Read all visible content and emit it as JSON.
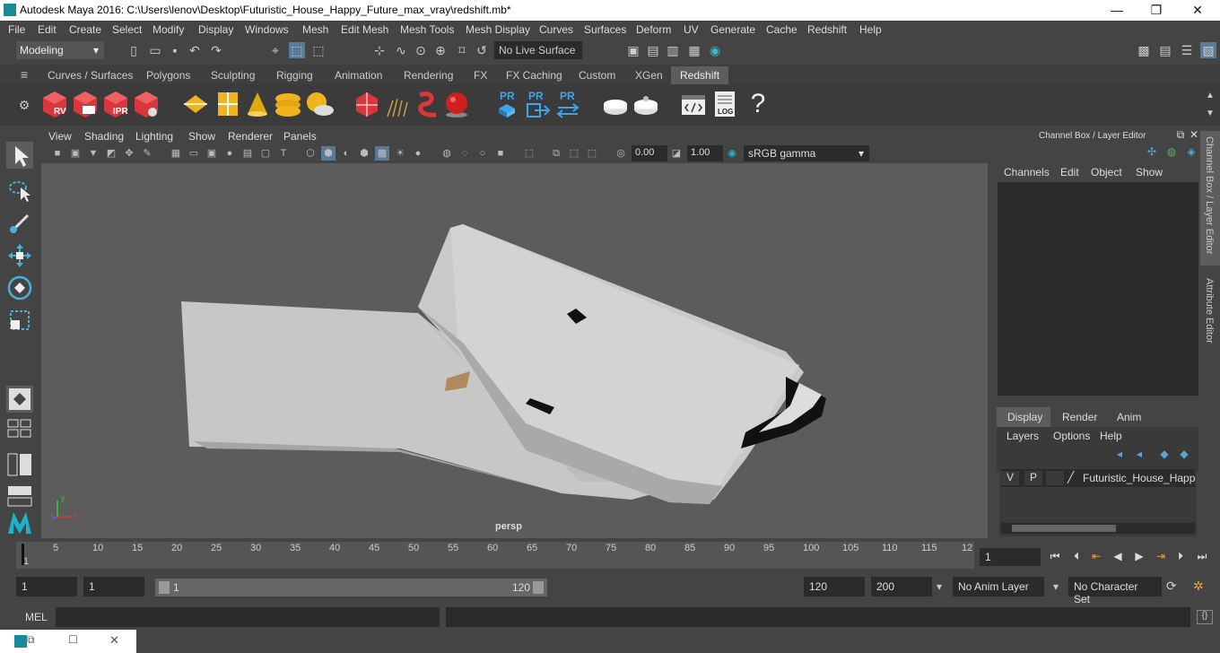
{
  "window": {
    "title": "Autodesk Maya 2016: C:\\Users\\lenov\\Desktop\\Futuristic_House_Happy_Future_max_vray\\redshift.mb*",
    "minimize": "—",
    "maximize": "❐",
    "close": "✕"
  },
  "menubar": {
    "items": [
      "File",
      "Edit",
      "Create",
      "Select",
      "Modify",
      "Display",
      "Windows",
      "Mesh",
      "Edit Mesh",
      "Mesh Tools",
      "Mesh Display",
      "Curves",
      "Surfaces",
      "Deform",
      "UV",
      "Generate",
      "Cache",
      "Redshift",
      "Help"
    ]
  },
  "statusline": {
    "mode": "Modeling",
    "live_surface": "No Live Surface"
  },
  "shelf": {
    "tabs": [
      "Curves / Surfaces",
      "Polygons",
      "Sculpting",
      "Rigging",
      "Animation",
      "Rendering",
      "FX",
      "FX Caching",
      "Custom",
      "XGen",
      "Redshift"
    ],
    "active_tab": "Redshift",
    "labels": {
      "rv": "RV",
      "ipr": "IPR",
      "pr1": "PR",
      "pr2": "PR",
      "pr3": "PR",
      "log": "LOG",
      "help": "?"
    }
  },
  "viewport": {
    "menus": [
      "View",
      "Shading",
      "Lighting",
      "Show",
      "Renderer",
      "Panels"
    ],
    "exposure": "0.00",
    "gamma_value": "1.00",
    "color_space": "sRGB gamma",
    "camera": "persp",
    "axis_x": "x",
    "axis_y": "y",
    "axis_z": "z"
  },
  "channelbox": {
    "title": "Channel Box / Layer Editor",
    "menus": [
      "Channels",
      "Edit",
      "Object",
      "Show"
    ],
    "layer_tabs": [
      "Display",
      "Render",
      "Anim"
    ],
    "active_layer_tab": "Display",
    "layer_menus": [
      "Layers",
      "Options",
      "Help"
    ],
    "layer": {
      "v": "V",
      "p": "P",
      "name": "Futuristic_House_Happy_"
    }
  },
  "side_tabs": [
    "Channel Box / Layer Editor",
    "Attribute Editor"
  ],
  "timeline": {
    "ticks": [
      "1",
      "5",
      "10",
      "15",
      "20",
      "25",
      "30",
      "35",
      "40",
      "45",
      "50",
      "55",
      "60",
      "65",
      "70",
      "75",
      "80",
      "85",
      "90",
      "95",
      "100",
      "105",
      "110",
      "115",
      "12"
    ],
    "current_frame": "1"
  },
  "range": {
    "start": "1",
    "playback_start": "1",
    "slider_start": "1",
    "slider_end": "120",
    "playback_end": "120",
    "end": "200",
    "anim_layer": "No Anim Layer",
    "char_set": "No Character Set"
  },
  "command": {
    "label": "MEL"
  }
}
